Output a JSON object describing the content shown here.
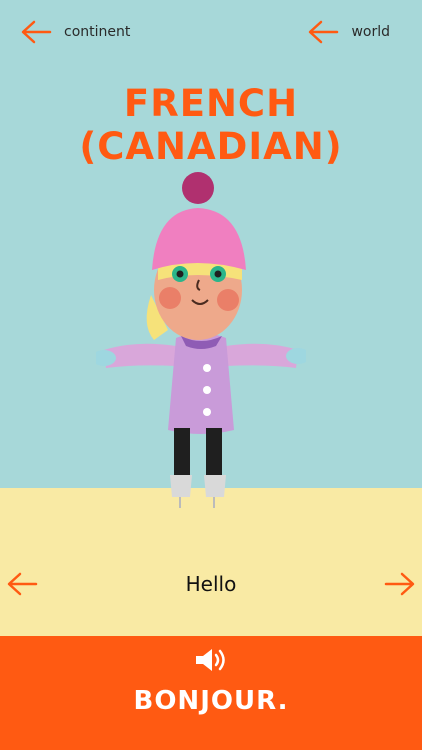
{
  "nav": {
    "left_label": "continent",
    "right_label": "world"
  },
  "title": "FRENCH (CANADIAN)",
  "phrase": "Hello",
  "translation": "BONJOUR.",
  "colors": {
    "accent": "#FF5A12",
    "sky": "#A7D8D9",
    "ground": "#F9EAA4"
  },
  "icons": {
    "back": "arrow-left-icon",
    "next": "arrow-right-icon",
    "audio": "speaker-icon"
  }
}
